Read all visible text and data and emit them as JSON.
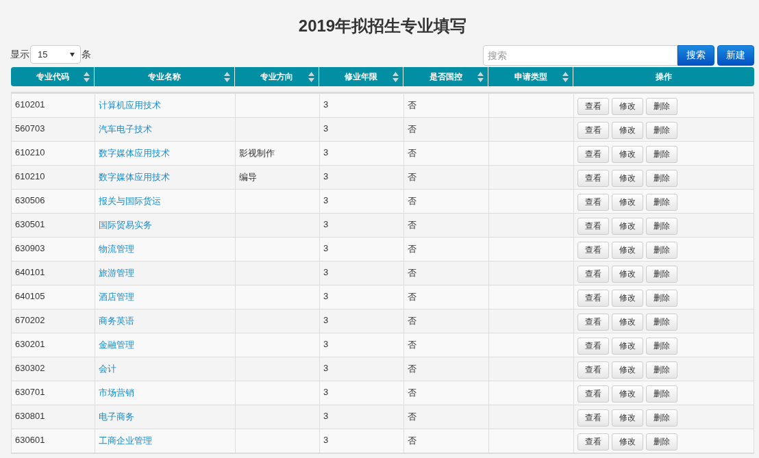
{
  "title": "2019年拟招生专业填写",
  "page_size": {
    "prefix": "显示",
    "value": "15",
    "suffix": "条"
  },
  "search": {
    "placeholder": "搜索",
    "button": "搜索"
  },
  "new_button": "新建",
  "table": {
    "columns": [
      {
        "label": "专业代码",
        "sortable": true
      },
      {
        "label": "专业名称",
        "sortable": true
      },
      {
        "label": "专业方向",
        "sortable": true
      },
      {
        "label": "修业年限",
        "sortable": true
      },
      {
        "label": "是否国控",
        "sortable": true
      },
      {
        "label": "申请类型",
        "sortable": true
      },
      {
        "label": "操作",
        "sortable": false
      }
    ],
    "rows": [
      {
        "code": "610201",
        "name": "计算机应用技术",
        "direction": "",
        "years": "3",
        "controlled": "否",
        "type": "",
        "actions": [
          "查看",
          "修改",
          "删除"
        ]
      },
      {
        "code": "560703",
        "name": "汽车电子技术",
        "direction": "",
        "years": "3",
        "controlled": "否",
        "type": "",
        "actions": [
          "查看",
          "修改",
          "删除"
        ]
      },
      {
        "code": "610210",
        "name": "数字媒体应用技术",
        "direction": "影视制作",
        "years": "3",
        "controlled": "否",
        "type": "",
        "actions": [
          "查看",
          "修改",
          "删除"
        ]
      },
      {
        "code": "610210",
        "name": "数字媒体应用技术",
        "direction": "编导",
        "years": "3",
        "controlled": "否",
        "type": "",
        "actions": [
          "查看",
          "修改",
          "删除"
        ]
      },
      {
        "code": "630506",
        "name": "报关与国际货运",
        "direction": "",
        "years": "3",
        "controlled": "否",
        "type": "",
        "actions": [
          "查看",
          "修改",
          "删除"
        ]
      },
      {
        "code": "630501",
        "name": "国际贸易实务",
        "direction": "",
        "years": "3",
        "controlled": "否",
        "type": "",
        "actions": [
          "查看",
          "修改",
          "删除"
        ]
      },
      {
        "code": "630903",
        "name": "物流管理",
        "direction": "",
        "years": "3",
        "controlled": "否",
        "type": "",
        "actions": [
          "查看",
          "修改",
          "删除"
        ]
      },
      {
        "code": "640101",
        "name": "旅游管理",
        "direction": "",
        "years": "3",
        "controlled": "否",
        "type": "",
        "actions": [
          "查看",
          "修改",
          "删除"
        ]
      },
      {
        "code": "640105",
        "name": "酒店管理",
        "direction": "",
        "years": "3",
        "controlled": "否",
        "type": "",
        "actions": [
          "查看",
          "修改",
          "删除"
        ]
      },
      {
        "code": "670202",
        "name": "商务英语",
        "direction": "",
        "years": "3",
        "controlled": "否",
        "type": "",
        "actions": [
          "查看",
          "修改",
          "删除"
        ]
      },
      {
        "code": "630201",
        "name": "金融管理",
        "direction": "",
        "years": "3",
        "controlled": "否",
        "type": "",
        "actions": [
          "查看",
          "修改",
          "删除"
        ]
      },
      {
        "code": "630302",
        "name": "会计",
        "direction": "",
        "years": "3",
        "controlled": "否",
        "type": "",
        "actions": [
          "查看",
          "修改",
          "删除"
        ]
      },
      {
        "code": "630701",
        "name": "市场营销",
        "direction": "",
        "years": "3",
        "controlled": "否",
        "type": "",
        "actions": [
          "查看",
          "修改",
          "删除"
        ]
      },
      {
        "code": "630801",
        "name": "电子商务",
        "direction": "",
        "years": "3",
        "controlled": "否",
        "type": "",
        "actions": [
          "查看",
          "修改",
          "删除"
        ]
      },
      {
        "code": "630601",
        "name": "工商企业管理",
        "direction": "",
        "years": "3",
        "controlled": "否",
        "type": "",
        "actions": [
          "查看",
          "修改",
          "删除"
        ]
      }
    ]
  }
}
